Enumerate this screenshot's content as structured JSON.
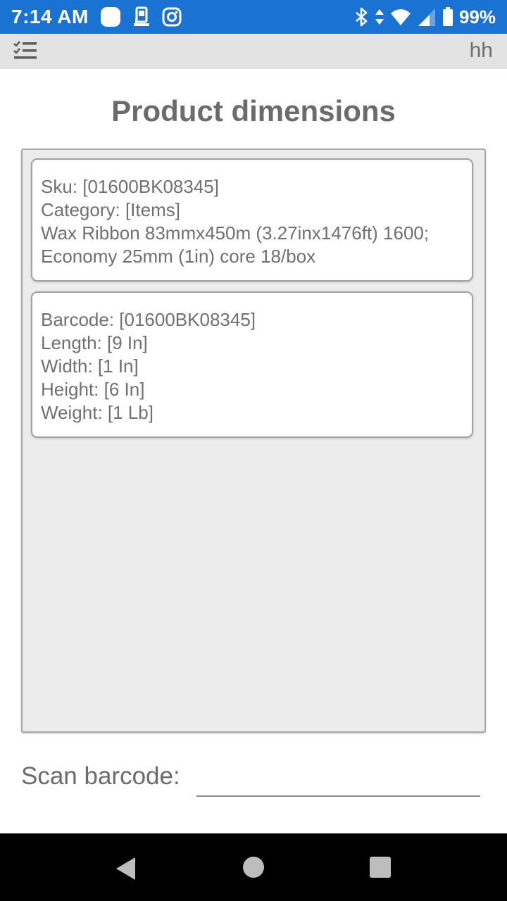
{
  "status_bar": {
    "time": "7:14 AM",
    "battery": "99%",
    "icons": [
      "notification-bubble-icon",
      "device-icon",
      "instagram-icon",
      "bluetooth-icon",
      "data-arrows-icon",
      "wifi-icon",
      "signal-icon",
      "battery-icon"
    ],
    "wifi_badge": "5"
  },
  "app_bar": {
    "menu_icon": "checklist-menu-icon",
    "user": "hh"
  },
  "page": {
    "title": "Product dimensions"
  },
  "product_card": {
    "sku": "Sku: [01600BK08345]",
    "category": "Category: [Items]",
    "description": "Wax Ribbon 83mmx450m (3.27inx1476ft) 1600; Economy 25mm (1in) core 18/box"
  },
  "dimensions_card": {
    "barcode": "Barcode: [01600BK08345]",
    "length": "Length: [9 In]",
    "width": "Width: [1 In]",
    "height": "Height: [6 In]",
    "weight": "Weight: [1 Lb]"
  },
  "scan": {
    "label": "Scan barcode:",
    "value": "",
    "placeholder": ""
  },
  "nav_bar": {
    "icons": [
      "back-icon",
      "home-icon",
      "recents-icon"
    ]
  },
  "colors": {
    "status_bar": "#1a73d2",
    "app_bar": "#e3e3e3",
    "panel": "#ececec",
    "text": "#707070",
    "nav_bar": "#000000"
  }
}
